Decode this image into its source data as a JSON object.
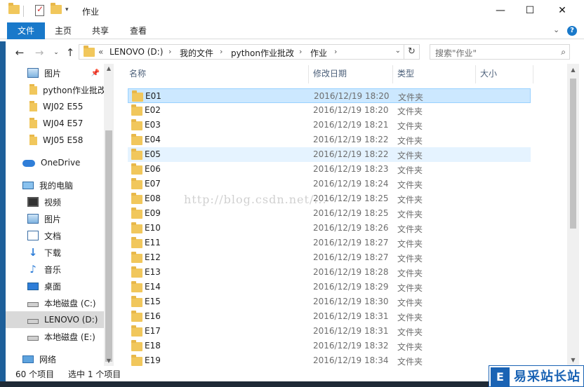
{
  "window": {
    "title": "作业",
    "minimize_glyph": "—",
    "maximize_glyph": "☐",
    "close_glyph": "✕"
  },
  "ribbon": {
    "tabs": [
      {
        "label": "文件"
      },
      {
        "label": "主页"
      },
      {
        "label": "共享"
      },
      {
        "label": "查看"
      }
    ],
    "expand_glyph": "⌄",
    "help_glyph": "?"
  },
  "address": {
    "overflow": "«",
    "crumbs": [
      "LENOVO (D:)",
      "我的文件",
      "python作业批改",
      "作业"
    ],
    "separator": "›",
    "refresh_glyph": "↻"
  },
  "search": {
    "placeholder": "搜索\"作业\"",
    "icon": "search-icon"
  },
  "nav": {
    "items": [
      {
        "label": "图片",
        "icon": "pictures-icon",
        "pinned": true
      },
      {
        "label": "python作业批改",
        "icon": "folder-icon"
      },
      {
        "label": "WJ02 E55",
        "icon": "folder-icon"
      },
      {
        "label": "WJ04 E57",
        "icon": "folder-icon"
      },
      {
        "label": "WJ05 E58",
        "icon": "folder-icon"
      },
      {
        "label": "OneDrive",
        "icon": "onedrive-icon"
      },
      {
        "label": "我的电脑",
        "icon": "computer-icon"
      },
      {
        "label": "视频",
        "icon": "videos-icon"
      },
      {
        "label": "图片",
        "icon": "pictures-icon"
      },
      {
        "label": "文档",
        "icon": "documents-icon"
      },
      {
        "label": "下载",
        "icon": "downloads-icon"
      },
      {
        "label": "音乐",
        "icon": "music-icon"
      },
      {
        "label": "桌面",
        "icon": "desktop-icon"
      },
      {
        "label": "本地磁盘 (C:)",
        "icon": "drive-icon"
      },
      {
        "label": "LENOVO (D:)",
        "icon": "drive-icon",
        "selected": true
      },
      {
        "label": "本地磁盘 (E:)",
        "icon": "drive-icon"
      },
      {
        "label": "网络",
        "icon": "network-icon"
      }
    ]
  },
  "columns": {
    "name": "名称",
    "date": "修改日期",
    "type": "类型",
    "size": "大小"
  },
  "files": [
    {
      "name": "E01",
      "date": "2016/12/19 18:20",
      "type": "文件夹"
    },
    {
      "name": "E02",
      "date": "2016/12/19 18:20",
      "type": "文件夹"
    },
    {
      "name": "E03",
      "date": "2016/12/19 18:21",
      "type": "文件夹"
    },
    {
      "name": "E04",
      "date": "2016/12/19 18:22",
      "type": "文件夹"
    },
    {
      "name": "E05",
      "date": "2016/12/19 18:22",
      "type": "文件夹"
    },
    {
      "name": "E06",
      "date": "2016/12/19 18:23",
      "type": "文件夹"
    },
    {
      "name": "E07",
      "date": "2016/12/19 18:24",
      "type": "文件夹"
    },
    {
      "name": "E08",
      "date": "2016/12/19 18:25",
      "type": "文件夹"
    },
    {
      "name": "E09",
      "date": "2016/12/19 18:25",
      "type": "文件夹"
    },
    {
      "name": "E10",
      "date": "2016/12/19 18:26",
      "type": "文件夹"
    },
    {
      "name": "E11",
      "date": "2016/12/19 18:27",
      "type": "文件夹"
    },
    {
      "name": "E12",
      "date": "2016/12/19 18:27",
      "type": "文件夹"
    },
    {
      "name": "E13",
      "date": "2016/12/19 18:28",
      "type": "文件夹"
    },
    {
      "name": "E14",
      "date": "2016/12/19 18:29",
      "type": "文件夹"
    },
    {
      "name": "E15",
      "date": "2016/12/19 18:30",
      "type": "文件夹"
    },
    {
      "name": "E16",
      "date": "2016/12/19 18:31",
      "type": "文件夹"
    },
    {
      "name": "E17",
      "date": "2016/12/19 18:31",
      "type": "文件夹"
    },
    {
      "name": "E18",
      "date": "2016/12/19 18:32",
      "type": "文件夹"
    },
    {
      "name": "E19",
      "date": "2016/12/19 18:34",
      "type": "文件夹"
    }
  ],
  "selection": {
    "selected_row": "E01",
    "hover_row": "E05"
  },
  "status": {
    "count": "60 个项目",
    "selected": "选中 1 个项目"
  },
  "watermark": "http://blog.csdn.net/...",
  "logo": {
    "mark": "E",
    "text": "易采站长站"
  },
  "colors": {
    "accent": "#1979ca",
    "folder": "#f1c75c",
    "selection": "#cce8ff",
    "hover": "#e5f3ff"
  }
}
